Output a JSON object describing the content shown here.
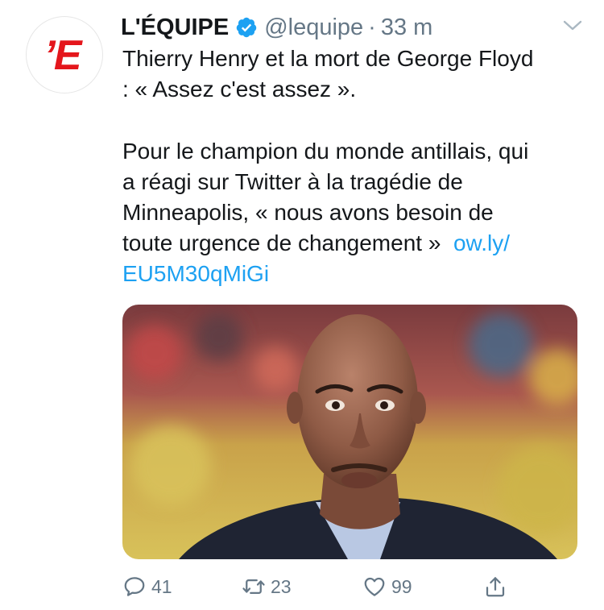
{
  "tweet": {
    "account_name": "L'ÉQUIPE",
    "handle": "@lequipe",
    "separator": "·",
    "time": "33 m",
    "avatar_text": "’E",
    "text_parts": [
      "Thierry Henry et la mort de George Floyd\n: « Assez c'est assez ».\n\nPour le champion du monde antillais, qui\na réagi sur Twitter à la tragédie de\nMinneapolis, « nous avons besoin de\ntoute urgence de changement »  ",
      "ow.ly/\nEU5M30qMiGi"
    ]
  },
  "actions": {
    "reply_count": "41",
    "retweet_count": "23",
    "like_count": "99"
  },
  "icons": {
    "verified": "verified-badge-icon",
    "menu": "chevron-down-icon",
    "reply": "reply-icon",
    "retweet": "retweet-icon",
    "like": "heart-icon",
    "share": "share-icon"
  },
  "colors": {
    "brand_red": "#e4161c",
    "link_blue": "#1da1f2",
    "secondary_gray": "#657786",
    "text": "#14171a"
  }
}
